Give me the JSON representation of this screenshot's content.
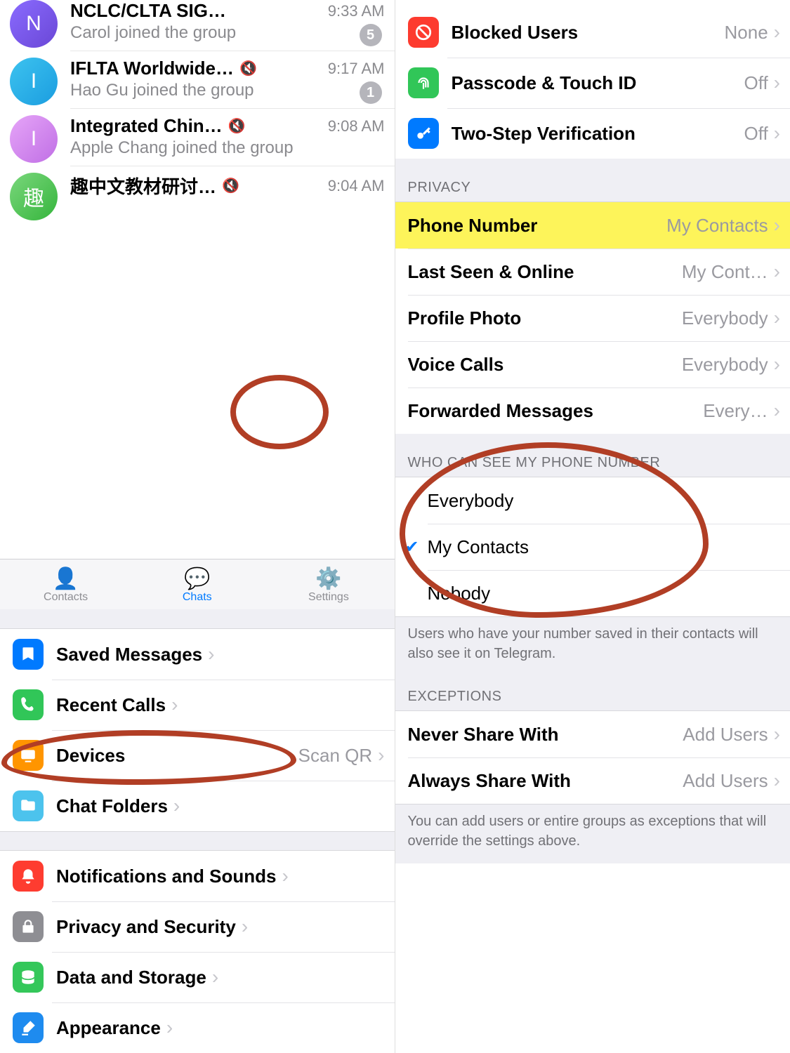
{
  "chats": [
    {
      "avatar_letter": "N",
      "avatar_class": "av-purple",
      "name": "NCLC/CLTA SIG…",
      "time": "9:33 AM",
      "subtitle": "Carol joined the group",
      "muted": false,
      "badge": "5"
    },
    {
      "avatar_letter": "I",
      "avatar_class": "av-blue",
      "name": "IFLTA Worldwide…",
      "time": "9:17 AM",
      "subtitle": "Hao Gu joined the group",
      "muted": true,
      "badge": "1"
    },
    {
      "avatar_letter": "I",
      "avatar_class": "av-lilac",
      "name": "Integrated Chin…",
      "time": "9:08 AM",
      "subtitle": "Apple Chang joined the group",
      "muted": true,
      "badge": ""
    },
    {
      "avatar_letter": "趣",
      "avatar_class": "av-green",
      "name": "趣中文教材研讨…",
      "time": "9:04 AM",
      "subtitle": "",
      "muted": true,
      "badge": ""
    }
  ],
  "tabbar": {
    "contacts": "Contacts",
    "chats": "Chats",
    "settings": "Settings"
  },
  "left_settings": {
    "saved_messages": "Saved Messages",
    "recent_calls": "Recent Calls",
    "devices": "Devices",
    "devices_value": "Scan QR",
    "chat_folders": "Chat Folders",
    "notifications": "Notifications and Sounds",
    "privacy": "Privacy and Security",
    "data": "Data and Storage",
    "appearance": "Appearance"
  },
  "right_top": {
    "blocked": {
      "label": "Blocked Users",
      "value": "None"
    },
    "passcode": {
      "label": "Passcode & Touch ID",
      "value": "Off"
    },
    "twostep": {
      "label": "Two-Step Verification",
      "value": "Off"
    }
  },
  "privacy_section": {
    "header": "PRIVACY",
    "phone": {
      "label": "Phone Number",
      "value": "My Contacts"
    },
    "last_seen": {
      "label": "Last Seen & Online",
      "value": "My Cont…"
    },
    "photo": {
      "label": "Profile Photo",
      "value": "Everybody"
    },
    "voice": {
      "label": "Voice Calls",
      "value": "Everybody"
    },
    "forward": {
      "label": "Forwarded Messages",
      "value": "Every…"
    }
  },
  "who_section": {
    "header": "WHO CAN SEE MY PHONE NUMBER",
    "options": {
      "everybody": "Everybody",
      "my_contacts": "My Contacts",
      "nobody": "Nobody"
    },
    "selected": "my_contacts",
    "footer": "Users who have your number saved in their contacts will also see it on Telegram."
  },
  "exceptions": {
    "header": "EXCEPTIONS",
    "never": {
      "label": "Never Share With",
      "value": "Add Users"
    },
    "always": {
      "label": "Always Share With",
      "value": "Add Users"
    },
    "footer": "You can add users or entire groups as exceptions that will override the settings above."
  }
}
